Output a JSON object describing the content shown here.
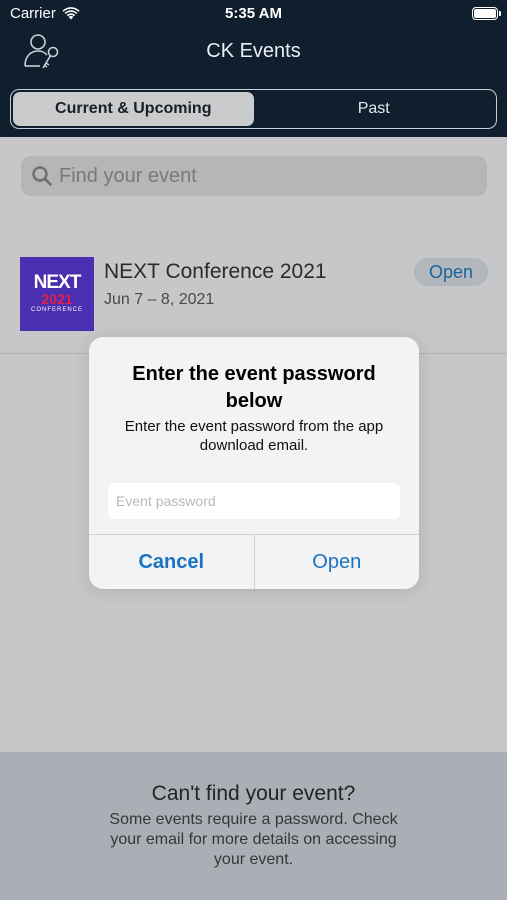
{
  "status_bar": {
    "carrier": "Carrier",
    "time": "5:35 AM"
  },
  "nav": {
    "title": "CK Events",
    "left_icon": "user-key-icon"
  },
  "tabs": [
    {
      "label": "Current & Upcoming",
      "selected": true
    },
    {
      "label": "Past",
      "selected": false
    }
  ],
  "search": {
    "placeholder": "Find your event"
  },
  "events": [
    {
      "name": "NEXT Conference 2021",
      "dates": "Jun 7 – 8, 2021",
      "action": "Open",
      "logo": {
        "line1": "NEXT",
        "line2": "2021",
        "line3": "CONFERENCE"
      }
    }
  ],
  "footer": {
    "title": "Can't find your event?",
    "text": "Some events require a password. Check your email for more details on accessing your event."
  },
  "dialog": {
    "title": "Enter the event password below",
    "message": "Enter the event password from the app download email.",
    "input_placeholder": "Event password",
    "cancel_label": "Cancel",
    "confirm_label": "Open"
  },
  "colors": {
    "header_bg": "#0f1f2e",
    "accent": "#1b73c0",
    "logo_bg": "#4a2fb0",
    "logo_year": "#e21f4a"
  }
}
